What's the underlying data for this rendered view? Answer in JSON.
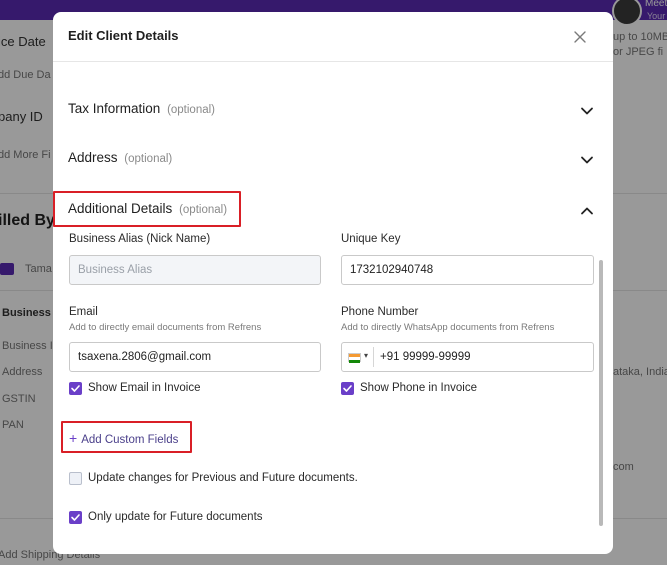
{
  "background": {
    "user_name": "Meet",
    "user_sub": "Your",
    "left_texts": [
      "ice Date",
      "dd Due Da",
      "pany ID",
      "dd More Fi",
      "illed By",
      "Tama",
      "Business",
      "Business I",
      "Address",
      "GSTIN",
      "PAN",
      "Add Shipping Details"
    ],
    "right_texts": [
      "up to 10MB",
      "or JPEG fi",
      "ataka, India",
      "com"
    ]
  },
  "modal": {
    "title": "Edit Client Details",
    "sections": [
      {
        "title": "Tax Information",
        "optional": "(optional)",
        "expanded": false
      },
      {
        "title": "Address",
        "optional": "(optional)",
        "expanded": false
      },
      {
        "title": "Additional Details",
        "optional": "(optional)",
        "expanded": true
      }
    ],
    "fields": {
      "alias_label": "Business Alias (Nick Name)",
      "alias_placeholder": "Business Alias",
      "alias_value": "",
      "unique_key_label": "Unique Key",
      "unique_key_value": "1732102940748",
      "email_label": "Email",
      "email_sub": "Add to directly email documents from Refrens",
      "email_value": "tsaxena.2806@gmail.com",
      "phone_label": "Phone Number",
      "phone_sub": "Add to directly WhatsApp documents from Refrens",
      "phone_value": "+91 99999-99999",
      "show_email_label": "Show Email in Invoice",
      "show_phone_label": "Show Phone in Invoice"
    },
    "add_custom_fields": "Add Custom Fields",
    "update_options": {
      "previous_future": "Update changes for Previous and Future documents.",
      "future_only": "Only update for Future documents"
    }
  },
  "colors": {
    "accent": "#6a3fc8",
    "highlight": "#d91f26",
    "topbar": "#5b2bb5"
  }
}
